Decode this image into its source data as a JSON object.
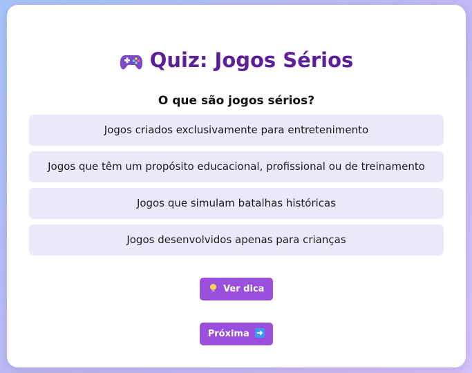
{
  "quiz": {
    "title_icon": "game-controller-icon",
    "title": "Quiz: Jogos Sérios",
    "question": "O que são jogos sérios?",
    "options": [
      "Jogos criados exclusivamente para entretenimento",
      "Jogos que têm um propósito educacional, profissional ou de treinamento",
      "Jogos que simulam batalhas históricas",
      "Jogos desenvolvidos apenas para crianças"
    ]
  },
  "buttons": {
    "hint": {
      "icon": "lightbulb-icon",
      "label": "Ver dica"
    },
    "next": {
      "icon": "arrow-right-icon",
      "label": "Próxima"
    }
  },
  "colors": {
    "title": "#5b1f9a",
    "option_bg": "#ede7fc",
    "button_bg": "#9b4fdd"
  }
}
